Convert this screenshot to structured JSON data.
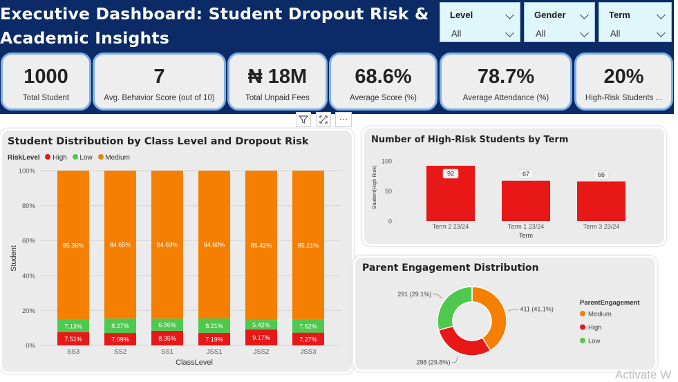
{
  "header": {
    "title_line1": "Executive Dashboard: Student Dropout Risk &",
    "title_line2": "Academic Insights"
  },
  "slicers": [
    {
      "label": "Level",
      "value": "All"
    },
    {
      "label": "Gender",
      "value": "All"
    },
    {
      "label": "Term",
      "value": "All"
    }
  ],
  "kpis": [
    {
      "value": "1000",
      "label": "Total Student"
    },
    {
      "value": "7",
      "label": "Avg. Behavior Score (out of 10)"
    },
    {
      "value": "₦ 18M",
      "label": "Total Unpaid Fees"
    },
    {
      "value": "68.6%",
      "label": "Average Score (%)"
    },
    {
      "value": "78.7%",
      "label": "Average Attendance (%)"
    },
    {
      "value": "20%",
      "label": "High-Risk Students ..."
    }
  ],
  "colors": {
    "high": "#e81818",
    "low": "#4fc84f",
    "medium": "#f57f00",
    "header": "#0b2a66",
    "kpi_border": "#7fb0e6"
  },
  "icons": [
    "filter-icon",
    "focus-mode-icon",
    "more-options-icon"
  ],
  "chart_data": [
    {
      "type": "bar",
      "stacked": "100%",
      "title": "Student Distribution by Class Level and Dropout Risk",
      "legend_title": "RiskLevel",
      "legend": [
        "High",
        "Low",
        "Medium"
      ],
      "legend_position": "top-left",
      "xlabel": "ClassLevel",
      "ylabel": "Student",
      "categories": [
        "SS3",
        "SS2",
        "SS1",
        "JSS1",
        "JSS2",
        "JSS3"
      ],
      "y_ticks": [
        "100%",
        "80%",
        "60%",
        "40%",
        "20%",
        "0%"
      ],
      "ylim": [
        0,
        100
      ],
      "series": [
        {
          "name": "High",
          "values": [
            7.51,
            7.09,
            8.35,
            7.19,
            9.17,
            7.27
          ],
          "labels": [
            "7.51%",
            "7.09%",
            "8.35%",
            "7.19%",
            "9.17%",
            "7.27%"
          ]
        },
        {
          "name": "Low",
          "values": [
            7.13,
            8.27,
            6.96,
            8.21,
            5.42,
            7.52
          ],
          "labels": [
            "7.13%",
            "8.27%",
            "6.96%",
            "8.21%",
            "5.42%",
            "7.52%"
          ]
        },
        {
          "name": "Medium",
          "values": [
            85.36,
            84.65,
            84.69,
            84.6,
            85.42,
            85.21
          ],
          "labels": [
            "85.36%",
            "84.65%",
            "84.69%",
            "84.60%",
            "85.42%",
            "85.21%"
          ]
        }
      ]
    },
    {
      "type": "bar",
      "title": "Number of High-Risk Students by Term",
      "xlabel": "Term",
      "ylabel": "Student(High Risk)",
      "categories": [
        "Term 2 23/24",
        "Term 1 23/24",
        "Term 3 23/24"
      ],
      "values": [
        92,
        67,
        66
      ],
      "y_ticks": [
        "100",
        "50",
        "0"
      ],
      "ylim": [
        0,
        100
      ]
    },
    {
      "type": "pie",
      "donut": true,
      "title": "Parent Engagement Distribution",
      "legend_title": "ParentEngagement",
      "legend_position": "right",
      "slices": [
        {
          "name": "Medium",
          "value": 411,
          "label": "411 (41.1%)"
        },
        {
          "name": "High",
          "value": 298,
          "label": "298 (29.8%)"
        },
        {
          "name": "Low",
          "value": 291,
          "label": "291 (29.1%)"
        }
      ]
    }
  ],
  "watermark": "Activate W"
}
